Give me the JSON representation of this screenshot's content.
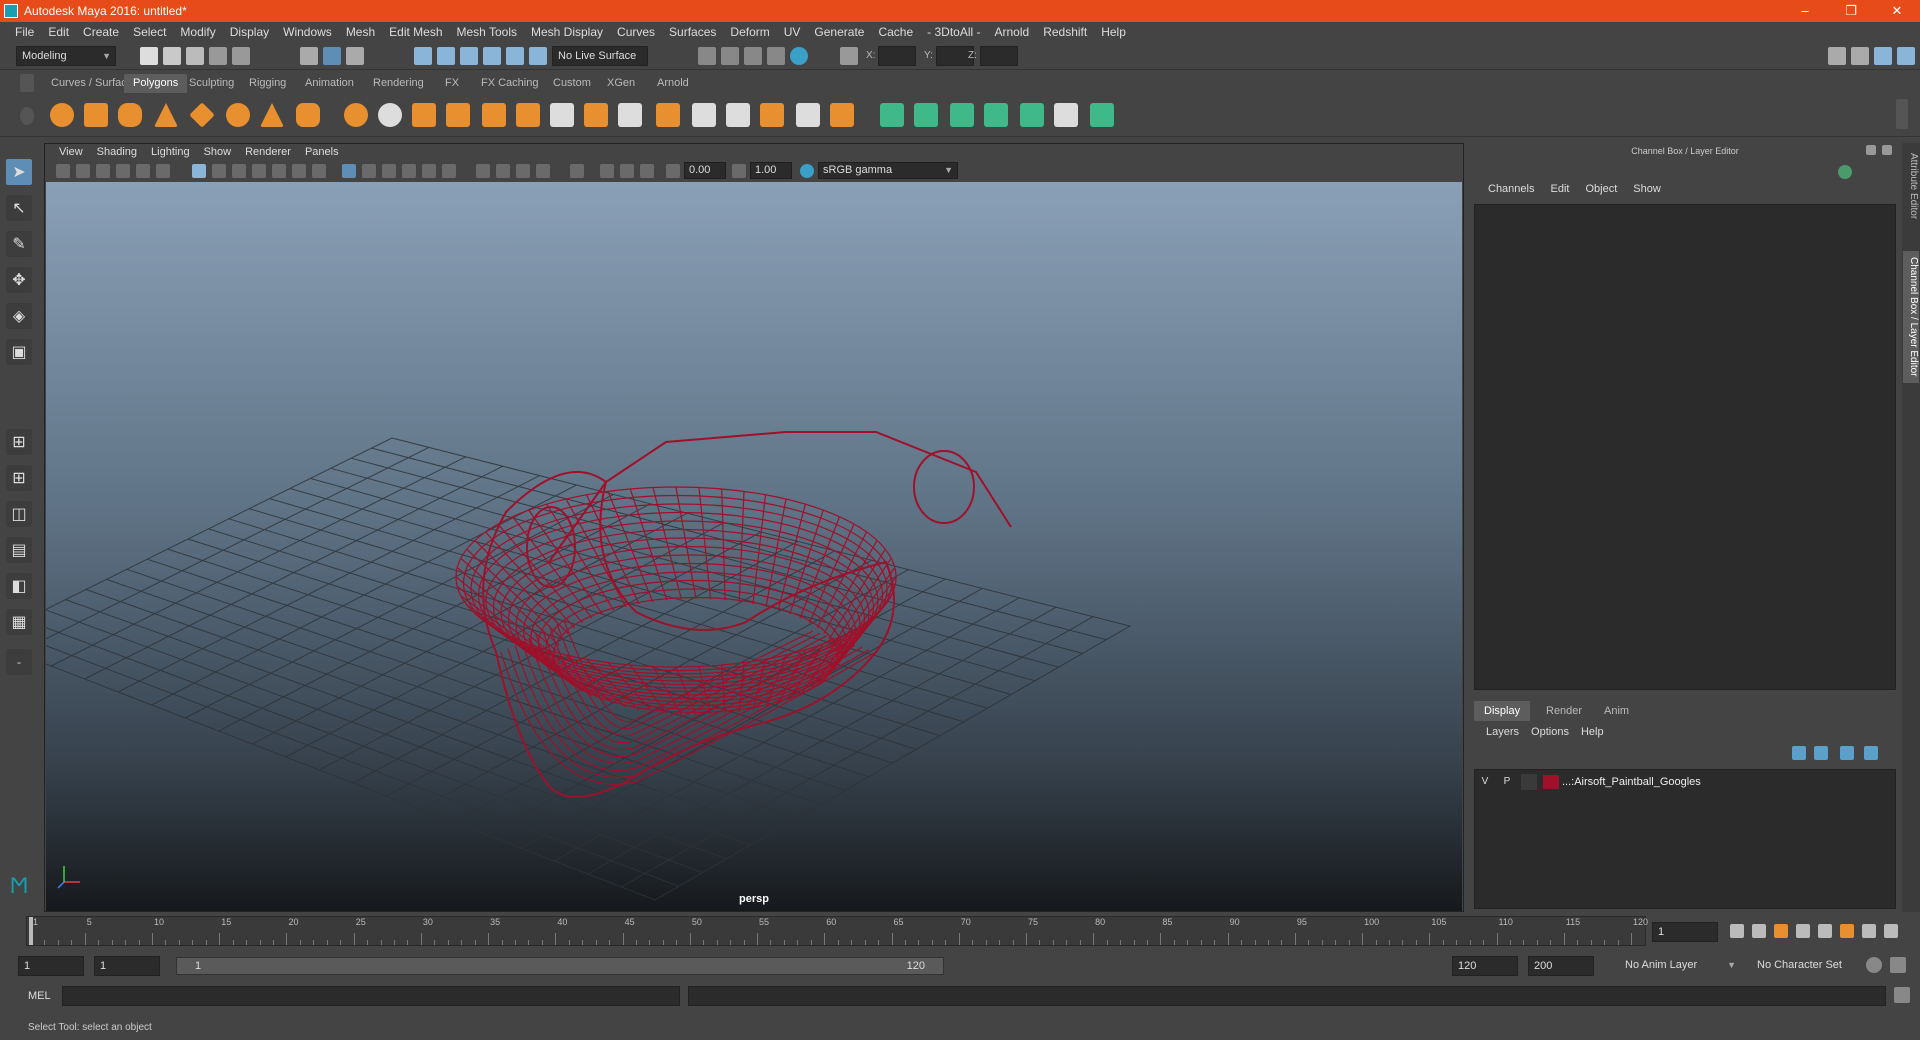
{
  "window": {
    "title": "Autodesk Maya 2016: untitled*",
    "controls": [
      "–",
      "❐",
      "✕"
    ]
  },
  "menubar": [
    "File",
    "Edit",
    "Create",
    "Select",
    "Modify",
    "Display",
    "Windows",
    "Mesh",
    "Edit Mesh",
    "Mesh Tools",
    "Mesh Display",
    "Curves",
    "Surfaces",
    "Deform",
    "UV",
    "Generate",
    "Cache",
    "- 3DtoAll -",
    "Arnold",
    "Redshift",
    "Help"
  ],
  "statusline": {
    "mode": "Modeling",
    "live_surface": "No Live Surface",
    "coord_labels": [
      "X:",
      "Y:",
      "Z:"
    ]
  },
  "shelf_tabs": [
    "Curves / Surfaces",
    "Polygons",
    "Sculpting",
    "Rigging",
    "Animation",
    "Rendering",
    "FX",
    "FX Caching",
    "Custom",
    "XGen",
    "Arnold"
  ],
  "shelf_active": "Polygons",
  "viewport": {
    "menu": [
      "View",
      "Shading",
      "Lighting",
      "Show",
      "Renderer",
      "Panels"
    ],
    "exposure": "0.00",
    "gamma": "1.00",
    "color_space": "sRGB gamma",
    "camera": "persp"
  },
  "channel_box": {
    "title": "Channel Box / Layer Editor",
    "menu": [
      "Channels",
      "Edit",
      "Object",
      "Show"
    ]
  },
  "layer_editor": {
    "tabs": [
      "Display",
      "Render",
      "Anim"
    ],
    "active_tab": "Display",
    "menu": [
      "Layers",
      "Options",
      "Help"
    ],
    "layers": [
      {
        "v": "V",
        "p": "P",
        "color": "#a0102a",
        "name": "...:Airsoft_Paintball_Googles"
      }
    ]
  },
  "side_tabs": [
    "Attribute Editor",
    "Channel Box / Layer Editor"
  ],
  "timeline": {
    "ticks": [
      "1",
      "5",
      "10",
      "15",
      "20",
      "25",
      "30",
      "35",
      "40",
      "45",
      "50",
      "55",
      "60",
      "65",
      "70",
      "75",
      "80",
      "85",
      "90",
      "95",
      "100",
      "105",
      "110",
      "115",
      "120"
    ],
    "current_frame": "1"
  },
  "range": {
    "start": "1",
    "playback_start": "1",
    "slider_start": "1",
    "slider_end": "120",
    "playback_end": "120",
    "end": "200",
    "anim_layer": "No Anim Layer",
    "character_set": "No Character Set"
  },
  "command_line": {
    "label": "MEL"
  },
  "help_line": "Select Tool: select an object",
  "colors": {
    "titlebar": "#e84b1a",
    "wireframe": "#a0102a",
    "active_tool": "#5e8db5"
  }
}
